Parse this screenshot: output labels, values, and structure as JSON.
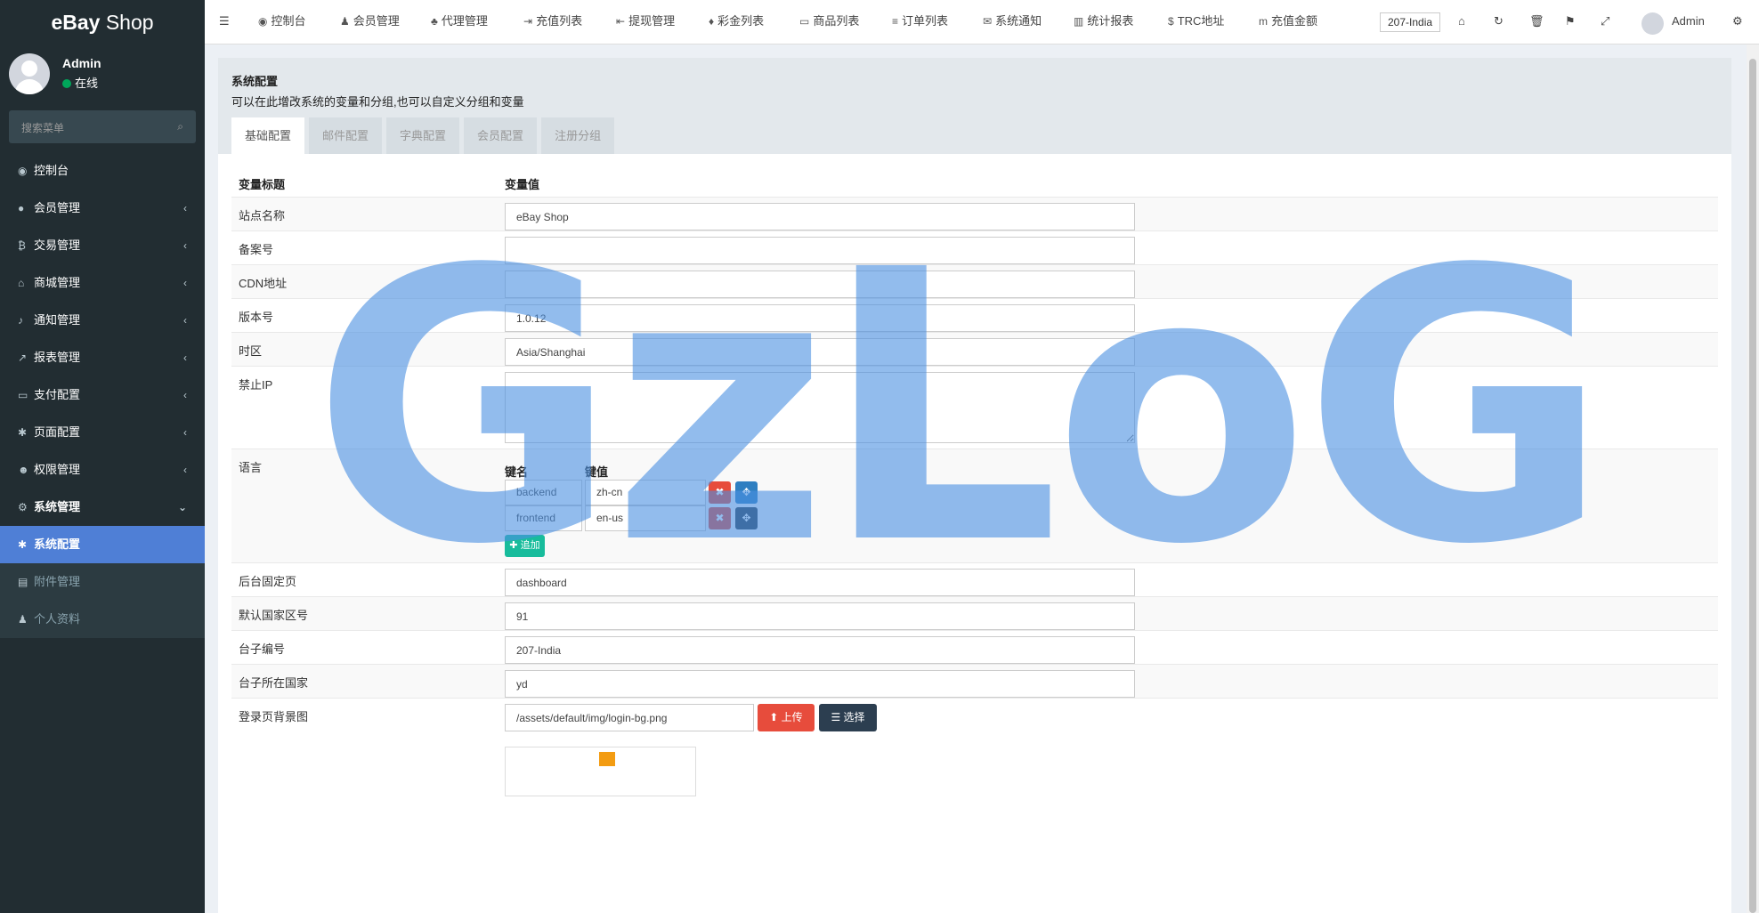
{
  "brand": {
    "title_bold": "eBay",
    "title_rest": " Shop"
  },
  "user": {
    "name": "Admin",
    "status": "在线"
  },
  "side_search": {
    "placeholder": "搜索菜单"
  },
  "sidebar": {
    "items": [
      {
        "icon": "dashboard-icon",
        "glyph": "◉",
        "label": "控制台",
        "arrow": ""
      },
      {
        "icon": "user-circle-icon",
        "glyph": "●",
        "label": "会员管理",
        "arrow": "‹"
      },
      {
        "icon": "bitcoin-icon",
        "glyph": "₿",
        "label": "交易管理",
        "arrow": "‹"
      },
      {
        "icon": "home-icon",
        "glyph": "⌂",
        "label": "商城管理",
        "arrow": "‹"
      },
      {
        "icon": "bell-icon",
        "glyph": "♪",
        "label": "通知管理",
        "arrow": "‹"
      },
      {
        "icon": "line-chart-icon",
        "glyph": "↗",
        "label": "报表管理",
        "arrow": "‹"
      },
      {
        "icon": "credit-card-icon",
        "glyph": "▭",
        "label": "支付配置",
        "arrow": "‹"
      },
      {
        "icon": "gear-icon",
        "glyph": "✱",
        "label": "页面配置",
        "arrow": "‹"
      },
      {
        "icon": "users-icon",
        "glyph": "☻",
        "label": "权限管理",
        "arrow": "‹"
      },
      {
        "icon": "cogs-icon",
        "glyph": "⚙",
        "label": "系统管理",
        "arrow": "⌄"
      }
    ],
    "sub_items": [
      {
        "icon": "gear-icon",
        "glyph": "✱",
        "label": "系统配置"
      },
      {
        "icon": "file-image-icon",
        "glyph": "▤",
        "label": "附件管理"
      },
      {
        "icon": "user-icon",
        "glyph": "♟",
        "label": "个人资料"
      }
    ]
  },
  "topnav": [
    {
      "icon": "dashboard-icon",
      "glyph": "◉",
      "label": "控制台"
    },
    {
      "icon": "user-icon",
      "glyph": "♟",
      "label": "会员管理"
    },
    {
      "icon": "sitemap-icon",
      "glyph": "♣",
      "label": "代理管理"
    },
    {
      "icon": "sign-in-icon",
      "glyph": "⇥",
      "label": "充值列表"
    },
    {
      "icon": "sign-out-icon",
      "glyph": "⇤",
      "label": "提现管理"
    },
    {
      "icon": "gift-icon",
      "glyph": "♦",
      "label": "彩金列表"
    },
    {
      "icon": "desktop-icon",
      "glyph": "▭",
      "label": "商品列表"
    },
    {
      "icon": "list-icon",
      "glyph": "≡",
      "label": "订单列表"
    },
    {
      "icon": "comments-icon",
      "glyph": "✉",
      "label": "系统通知"
    },
    {
      "icon": "bar-chart-icon",
      "glyph": "▥",
      "label": "统计报表"
    },
    {
      "icon": "dollar-icon",
      "glyph": "$",
      "label": "TRC地址"
    },
    {
      "icon": "money-icon",
      "glyph": "m",
      "label": "充值金额"
    }
  ],
  "top_tag": "207-India",
  "top_user": "Admin",
  "panel": {
    "title": "系统配置",
    "desc": "可以在此增改系统的变量和分组,也可以自定义分组和变量"
  },
  "tabs": [
    "基础配置",
    "邮件配置",
    "字典配置",
    "会员配置",
    "注册分组"
  ],
  "columns": {
    "title": "变量标题",
    "value": "变量值"
  },
  "fields": [
    {
      "label": "站点名称",
      "value": "eBay Shop"
    },
    {
      "label": "备案号",
      "value": ""
    },
    {
      "label": "CDN地址",
      "value": ""
    },
    {
      "label": "版本号",
      "value": "1.0.12"
    },
    {
      "label": "时区",
      "value": "Asia/Shanghai"
    },
    {
      "label": "禁止IP",
      "value": ""
    },
    {
      "label": "语言",
      "value": ""
    },
    {
      "label": "后台固定页",
      "value": "dashboard"
    },
    {
      "label": "默认国家区号",
      "value": "91"
    },
    {
      "label": "台子编号",
      "value": "207-India"
    },
    {
      "label": "台子所在国家",
      "value": "yd"
    },
    {
      "label": "登录页背景图",
      "value": "/assets/default/img/login-bg.png"
    }
  ],
  "lang": {
    "key_header": "键名",
    "val_header": "键值",
    "rows": [
      {
        "key": "backend",
        "val": "zh-cn"
      },
      {
        "key": "frontend",
        "val": "en-us"
      }
    ],
    "add_label": "✚ 追加"
  },
  "upload": {
    "upload_label": "⬆ 上传",
    "choose_label": "☰ 选择"
  },
  "watermark": "GzLoG"
}
